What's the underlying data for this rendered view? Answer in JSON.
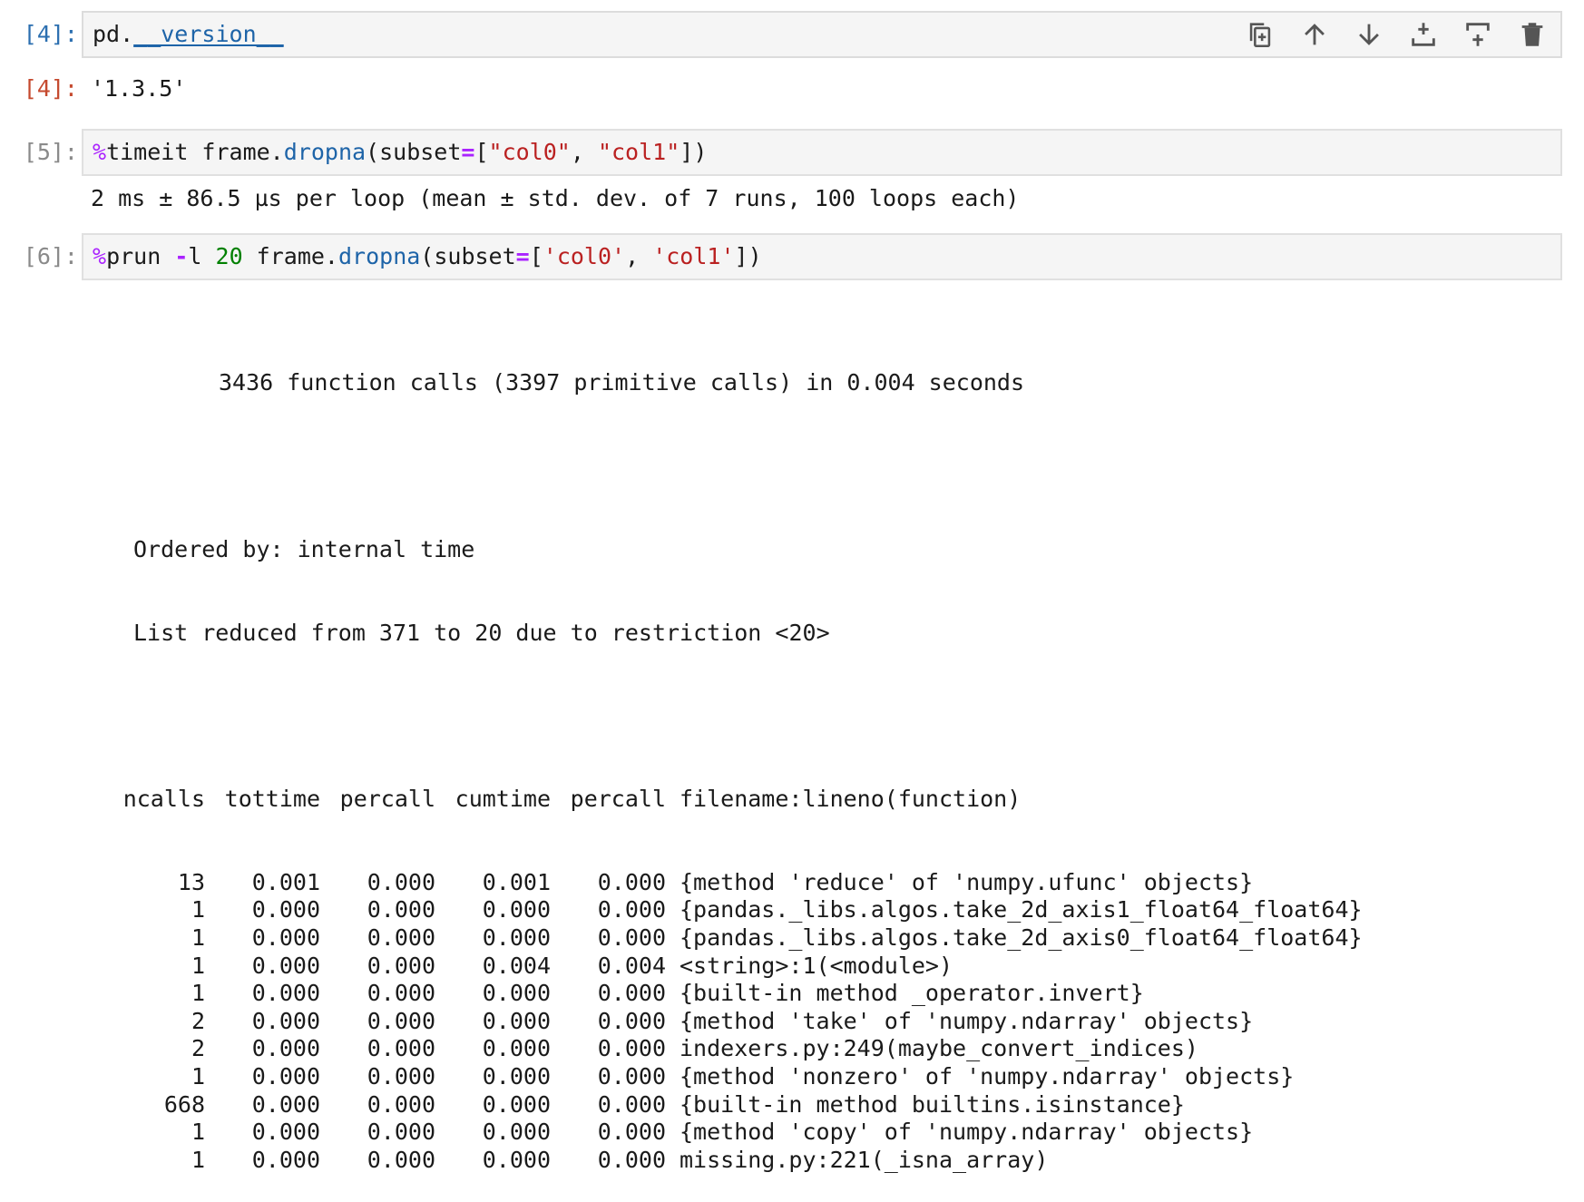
{
  "cells": [
    {
      "prompt": "[4]:",
      "code_prefix": "pd.",
      "code_dunder": "__version__"
    },
    {
      "out_prompt": "[4]:",
      "output": "'1.3.5'"
    },
    {
      "prompt": "[5]:",
      "magic": "%",
      "cmd": "timeit",
      "code_a": " frame.",
      "fn": "dropna",
      "code_b": "(subset",
      "op": "=",
      "code_c": "[",
      "s1": "\"col0\"",
      "sep": ", ",
      "s2": "\"col1\"",
      "code_d": "])",
      "output": "2 ms ± 86.5 µs per loop (mean ± std. dev. of 7 runs, 100 loops each)"
    },
    {
      "prompt": "[6]:",
      "magic": "%",
      "cmd": "prun",
      "flag_pre": " ",
      "flag_op": "-",
      "flag": "l ",
      "num": "20",
      "code_a": " frame.",
      "fn": "dropna",
      "code_b": "(subset",
      "op": "=",
      "code_c": "[",
      "s1": "'col0'",
      "sep": ", ",
      "s2": "'col1'",
      "code_d": "])"
    }
  ],
  "profile": {
    "summary": "3436 function calls (3397 primitive calls) in 0.004 seconds",
    "ordered_by": "Ordered by: internal time",
    "reduced": "List reduced from 371 to 20 due to restriction <20>",
    "headers": [
      "ncalls",
      "tottime",
      "percall",
      "cumtime",
      "percall",
      "filename:lineno(function)"
    ],
    "rows": [
      [
        "13",
        "0.001",
        "0.000",
        "0.001",
        "0.000",
        "{method 'reduce' of 'numpy.ufunc' objects}"
      ],
      [
        "1",
        "0.000",
        "0.000",
        "0.000",
        "0.000",
        "{pandas._libs.algos.take_2d_axis1_float64_float64}"
      ],
      [
        "1",
        "0.000",
        "0.000",
        "0.000",
        "0.000",
        "{pandas._libs.algos.take_2d_axis0_float64_float64}"
      ],
      [
        "1",
        "0.000",
        "0.000",
        "0.004",
        "0.004",
        "<string>:1(<module>)"
      ],
      [
        "1",
        "0.000",
        "0.000",
        "0.000",
        "0.000",
        "{built-in method _operator.invert}"
      ],
      [
        "2",
        "0.000",
        "0.000",
        "0.000",
        "0.000",
        "{method 'take' of 'numpy.ndarray' objects}"
      ],
      [
        "2",
        "0.000",
        "0.000",
        "0.000",
        "0.000",
        "indexers.py:249(maybe_convert_indices)"
      ],
      [
        "1",
        "0.000",
        "0.000",
        "0.000",
        "0.000",
        "{method 'nonzero' of 'numpy.ndarray' objects}"
      ],
      [
        "668",
        "0.000",
        "0.000",
        "0.000",
        "0.000",
        "{built-in method builtins.isinstance}"
      ],
      [
        "1",
        "0.000",
        "0.000",
        "0.000",
        "0.000",
        "{method 'copy' of 'numpy.ndarray' objects}"
      ],
      [
        "1",
        "0.000",
        "0.000",
        "0.000",
        "0.000",
        "missing.py:221(_isna_array)"
      ]
    ]
  },
  "toolbar": [
    "duplicate-cell-icon",
    "move-up-icon",
    "move-down-icon",
    "insert-below-icon",
    "insert-above-icon",
    "delete-cell-icon"
  ]
}
